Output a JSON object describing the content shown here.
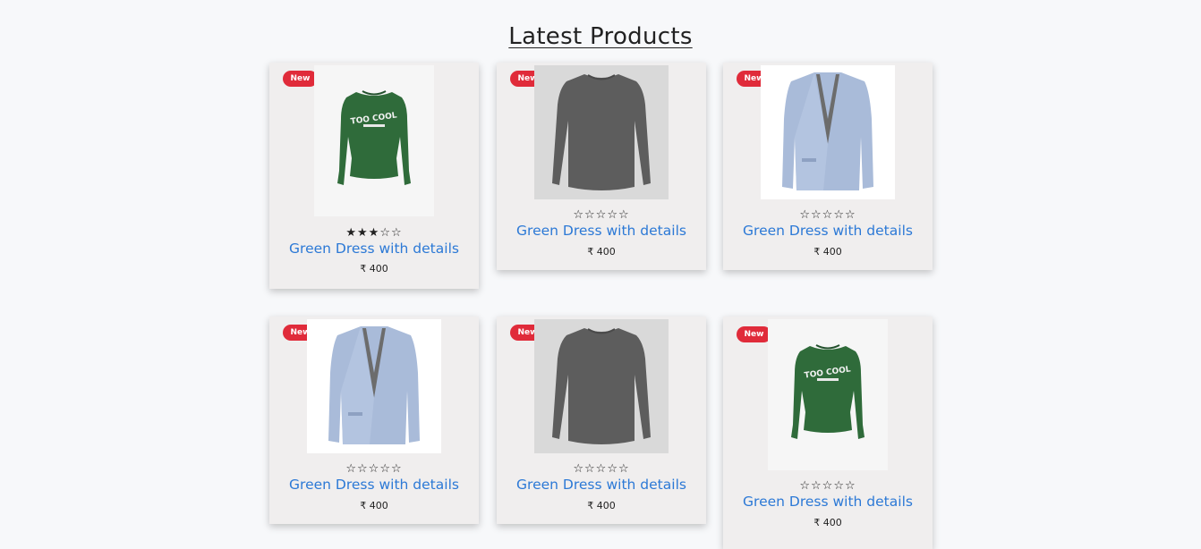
{
  "page": {
    "title": "Latest Products"
  },
  "currency": "₹",
  "products": [
    {
      "badge": "New",
      "name": "Green Dress with details",
      "price": "₹ 400",
      "rating": 3,
      "rating_max": 5,
      "stars_text": "★★★☆☆",
      "image": "green-sweatshirt-image",
      "image_caption": "TOO COOL"
    },
    {
      "badge": "New",
      "name": "Green Dress with details",
      "price": "₹ 400",
      "rating": 0,
      "rating_max": 5,
      "stars_text": "☆☆☆☆☆",
      "image": "grey-sweater-image"
    },
    {
      "badge": "New",
      "name": "Green Dress with details",
      "price": "₹ 400",
      "rating": 0,
      "rating_max": 5,
      "stars_text": "☆☆☆☆☆",
      "image": "blue-blazer-image"
    },
    {
      "badge": "New",
      "name": "Green Dress with details",
      "price": "₹ 400",
      "rating": 0,
      "rating_max": 5,
      "stars_text": "☆☆☆☆☆",
      "image": "blue-blazer-image"
    },
    {
      "badge": "New",
      "name": "Green Dress with details",
      "price": "₹ 400",
      "rating": 0,
      "rating_max": 5,
      "stars_text": "☆☆☆☆☆",
      "image": "grey-sweater-image"
    },
    {
      "badge": "New",
      "name": "Green Dress with details",
      "price": "₹ 400",
      "rating": 0,
      "rating_max": 5,
      "stars_text": "☆☆☆☆☆",
      "image": "green-sweatshirt-image",
      "image_caption": "TOO COOL"
    }
  ],
  "colors": {
    "badge": "#e02b3a",
    "link": "#2c79d6",
    "card": "#f0eeee",
    "page": "#f7f8fa"
  }
}
